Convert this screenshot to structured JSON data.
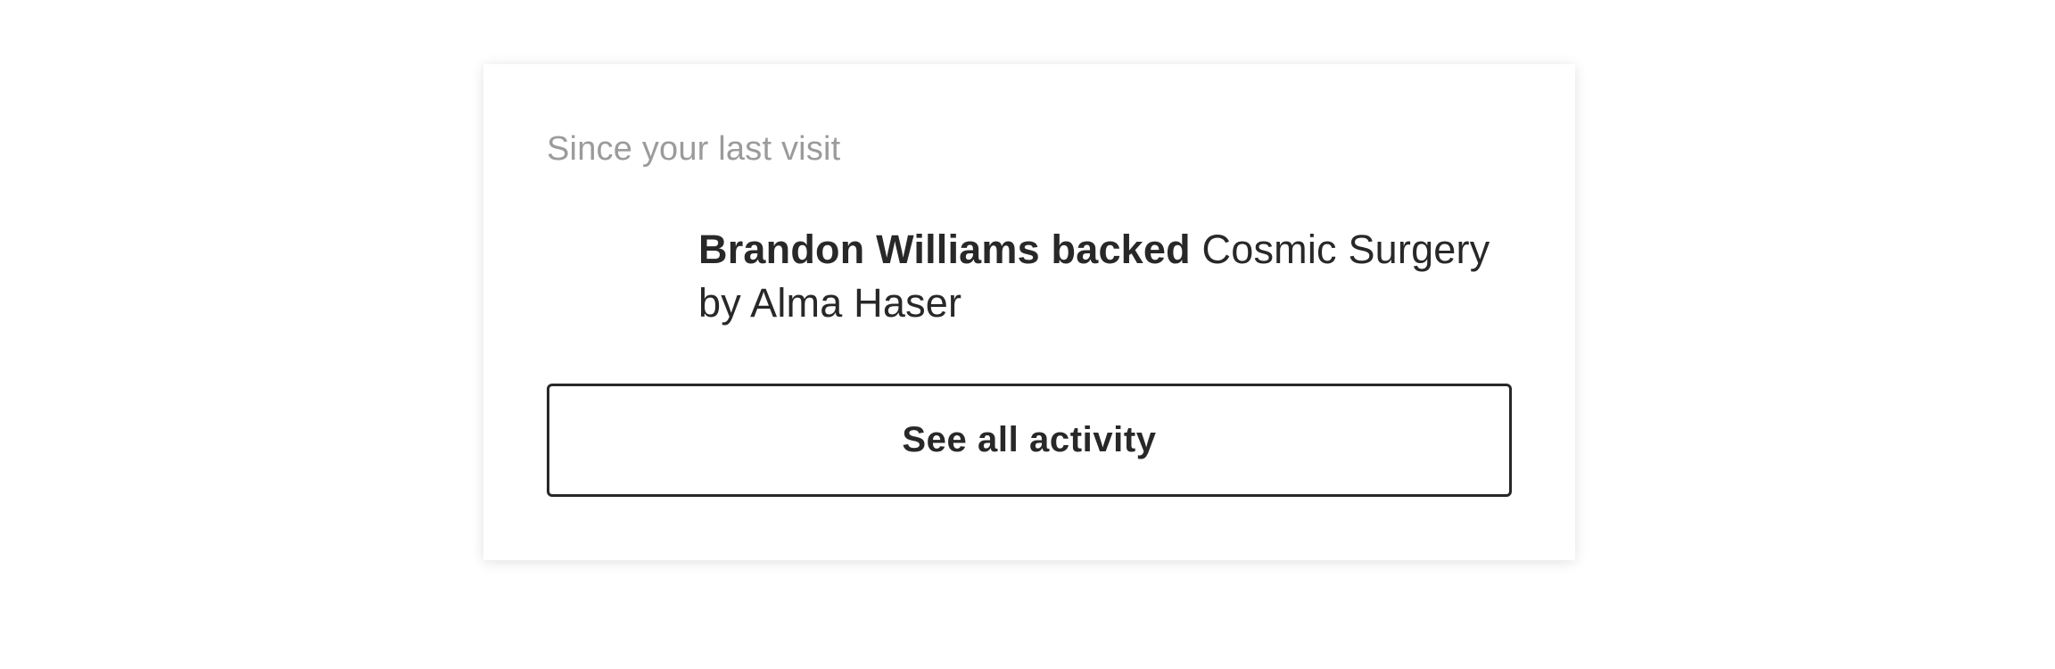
{
  "activity_card": {
    "heading": "Since your last visit",
    "items": [
      {
        "actor": "Brandon Williams backed",
        "project": "Cosmic Surgery",
        "creator_line": "by Alma Haser"
      }
    ],
    "see_all_label": "See all activity"
  },
  "colors": {
    "heading_text": "#9b9b9b",
    "body_text": "#282828",
    "button_border": "#282828",
    "card_background": "#ffffff"
  }
}
